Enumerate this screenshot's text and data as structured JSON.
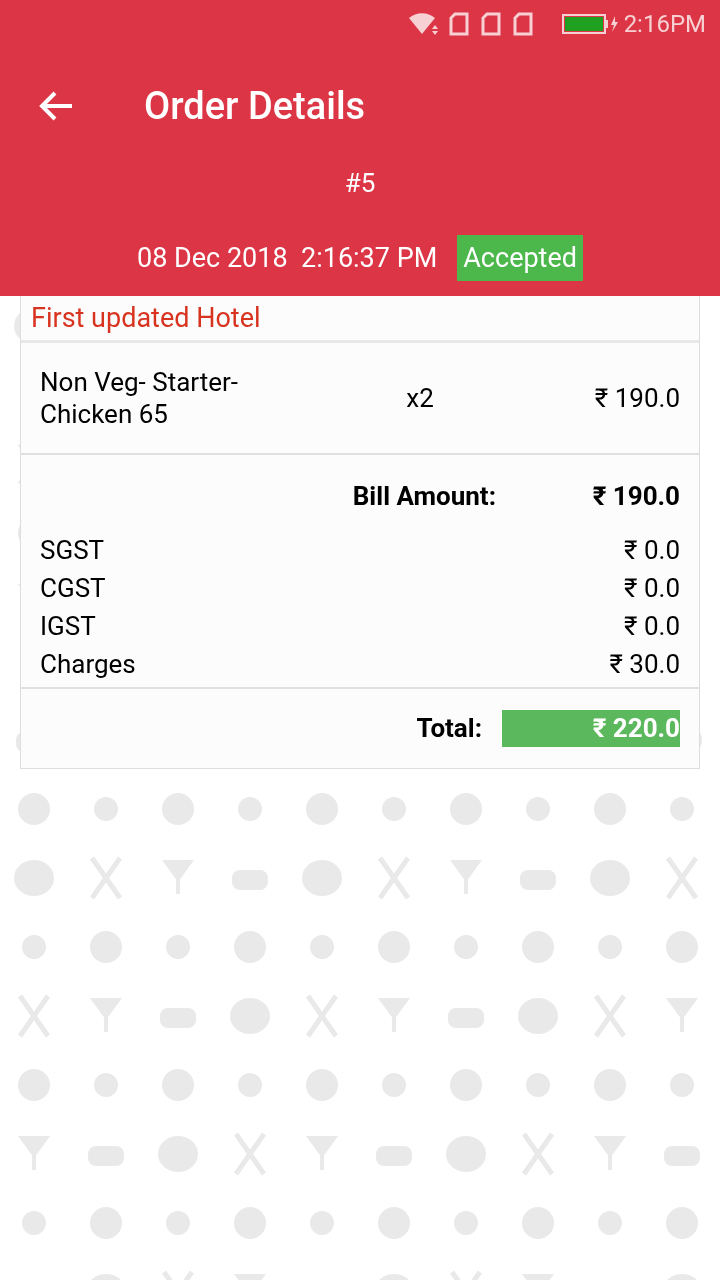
{
  "status_bar": {
    "time": "2:16PM"
  },
  "header": {
    "title": "Order Details",
    "order_number": "#5",
    "date": "08 Dec 2018",
    "time": "2:16:37 PM",
    "status": "Accepted"
  },
  "hotel_name": "First updated Hotel",
  "items": [
    {
      "name": "Non Veg- Starter-\nChicken 65",
      "quantity": "x2",
      "price": "₹ 190.0"
    }
  ],
  "bill": {
    "label": "Bill Amount:",
    "amount": "₹ 190.0"
  },
  "charges": [
    {
      "label": "SGST",
      "amount": "₹ 0.0"
    },
    {
      "label": "CGST",
      "amount": "₹ 0.0"
    },
    {
      "label": "IGST",
      "amount": "₹ 0.0"
    },
    {
      "label": "Charges",
      "amount": "₹ 30.0"
    }
  ],
  "total": {
    "label": "Total:",
    "amount": "₹ 220.0"
  }
}
